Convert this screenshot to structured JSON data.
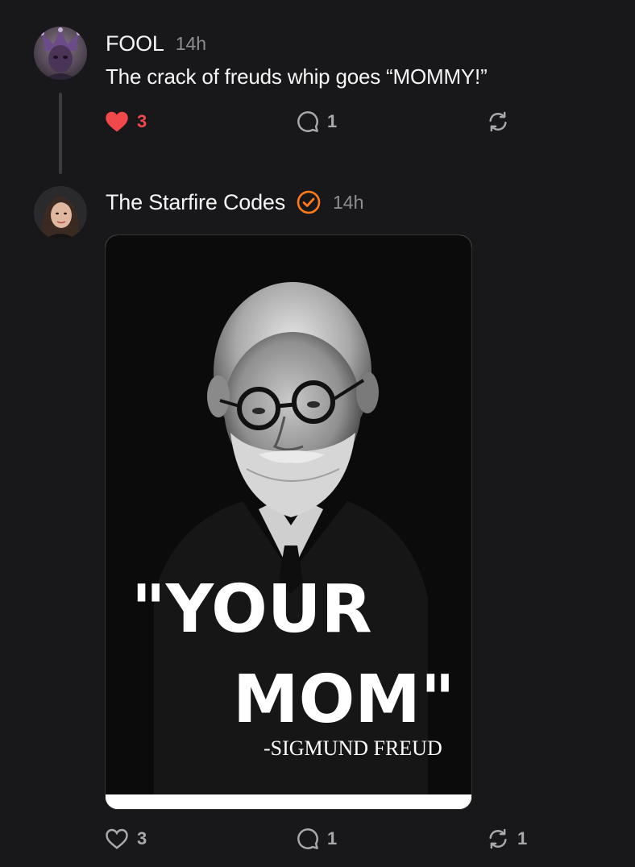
{
  "colors": {
    "background": "#18181a",
    "like_active": "#f0484b",
    "verified": "#ff7a1a",
    "muted_text": "#8e8e93"
  },
  "posts": [
    {
      "username": "FOOL",
      "timestamp": "14h",
      "text": "The crack of freuds whip goes “MOMMY!”",
      "avatar_icon": "jester-avatar",
      "likes": "3",
      "liked": true,
      "replies": "1",
      "reposts": ""
    },
    {
      "username": "The Starfire Codes",
      "verified": true,
      "verified_icon": "verified-check-icon",
      "timestamp": "14h",
      "avatar_icon": "user-avatar",
      "image": {
        "quote_line_1": "\"YOUR",
        "quote_line_2": "MOM\"",
        "attribution": "-SIGMUND FREUD"
      },
      "likes": "3",
      "liked": false,
      "replies": "1",
      "reposts": "1"
    }
  ]
}
